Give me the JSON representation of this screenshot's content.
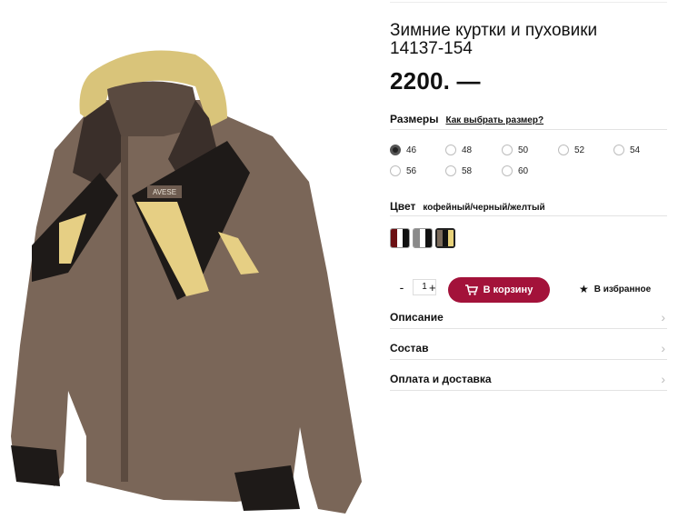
{
  "product": {
    "title_line1": "Зимние куртки и пуховики",
    "title_line2": "14137-154",
    "price": "2200. —",
    "brand_label": "AVESE"
  },
  "sizes_section": {
    "label": "Размеры",
    "help_link": "Как выбрать размер?",
    "options": [
      "46",
      "48",
      "50",
      "52",
      "54",
      "56",
      "58",
      "60"
    ],
    "selected": "46"
  },
  "color_section": {
    "label": "Цвет",
    "value": "кофейный/черный/желтый",
    "swatches": [
      {
        "name": "burgundy-white-black",
        "colors": [
          "#6b0f12",
          "#ffffff",
          "#111111"
        ]
      },
      {
        "name": "grey-white-black",
        "colors": [
          "#8a8a8a",
          "#ffffff",
          "#111111"
        ]
      },
      {
        "name": "coffee-black-yellow",
        "colors": [
          "#7a6a5a",
          "#111111",
          "#e8d27a"
        ]
      }
    ],
    "selected_index": 2
  },
  "cart": {
    "minus": "-",
    "qty_value": "1",
    "plus": "+",
    "add_button": "В корзину",
    "favorites": "В избранное",
    "accent_color": "#a3123a"
  },
  "accordion": [
    {
      "label": "Описание"
    },
    {
      "label": "Состав"
    },
    {
      "label": "Оплата и доставка"
    }
  ]
}
